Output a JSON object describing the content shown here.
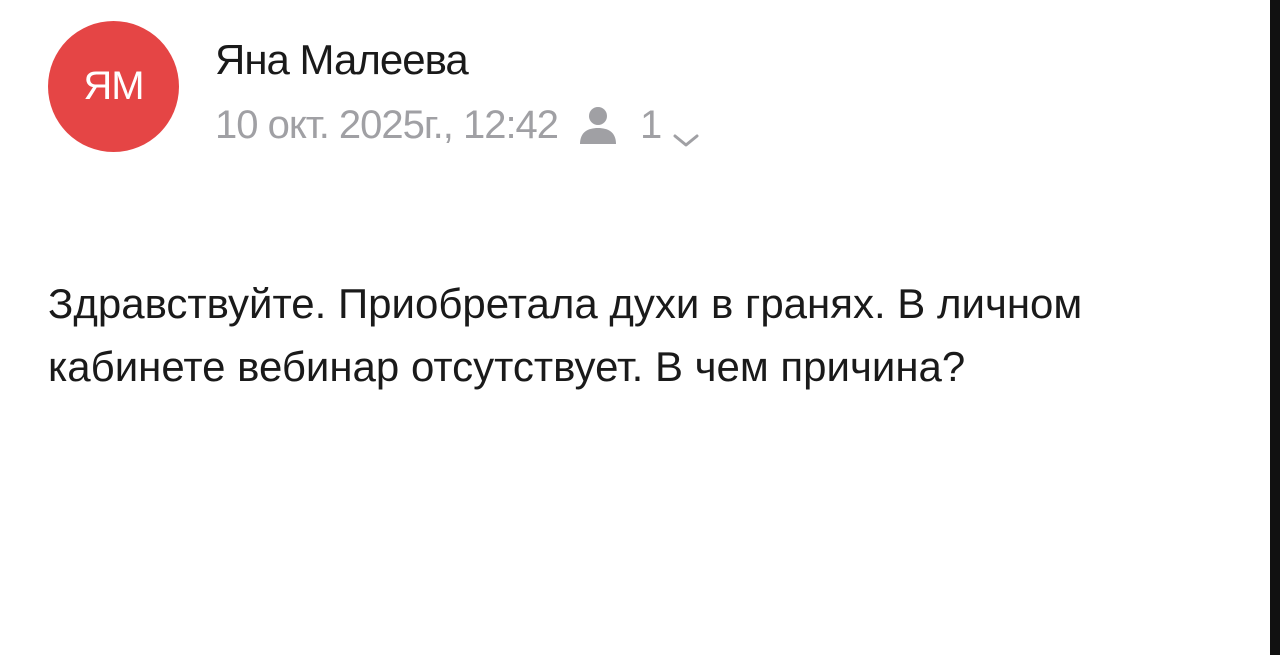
{
  "sender": {
    "initials": "ЯМ",
    "name": "Яна Малеева",
    "avatar_color": "#e54545"
  },
  "meta": {
    "date": "10 окт. 2025г., 12:42",
    "recipients_icon": "person-icon",
    "recipients_count": "1",
    "expand_icon": "chevron-down-icon"
  },
  "message": {
    "body": "Здравствуйте. Приобретала духи в гранях. В личном кабинете вебинар отсутствует. В чем причина?"
  }
}
